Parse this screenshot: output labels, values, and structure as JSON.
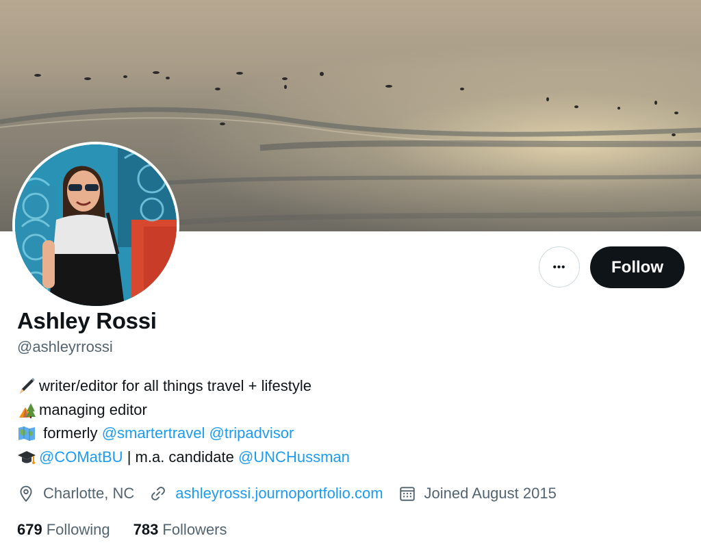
{
  "profile": {
    "display_name": "Ashley Rossi",
    "handle": "@ashleyrrossi"
  },
  "actions": {
    "more_label": "•••",
    "follow_label": "Follow"
  },
  "bio": {
    "line1": {
      "emoji": "pen-icon",
      "text": "writer/editor for all things travel + lifestyle"
    },
    "line2": {
      "emoji": "camping-icon",
      "text": "managing editor"
    },
    "line3": {
      "emoji": "map-icon",
      "prefix": " formerly ",
      "mention1": "@smartertravel",
      "mention2": "@tripadvisor"
    },
    "line4": {
      "emoji": "graduation-cap-icon",
      "mention1": "@COMatBU",
      "middle": " | m.a. candidate ",
      "mention2": "@UNCHussman"
    }
  },
  "meta": {
    "location": "Charlotte, NC",
    "website": "ashleyrossi.journoportfolio.com",
    "joined": "Joined August 2015"
  },
  "stats": {
    "following_count": "679",
    "following_label": "Following",
    "followers_count": "783",
    "followers_label": "Followers"
  },
  "colors": {
    "link": "#1d9bf0",
    "primary_text": "#0f1419",
    "secondary_text": "#536471",
    "follow_button_bg": "#0f1419"
  }
}
